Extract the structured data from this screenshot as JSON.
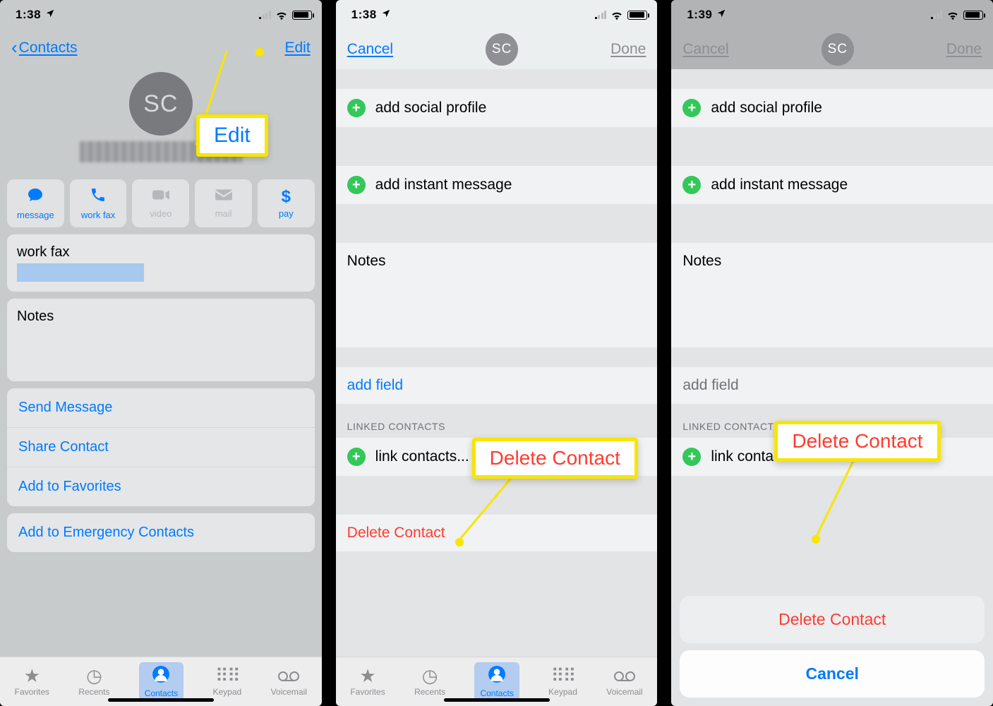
{
  "status": {
    "time1": "1:38",
    "time2": "1:38",
    "time3": "1:39"
  },
  "panel1": {
    "back": "Contacts",
    "edit": "Edit",
    "initials": "SC",
    "callout": "Edit",
    "actions": {
      "message": "message",
      "workfax": "work fax",
      "video": "video",
      "mail": "mail",
      "pay": "pay"
    },
    "workfax_label": "work fax",
    "notes_label": "Notes",
    "send_message": "Send Message",
    "share_contact": "Share Contact",
    "add_favorites": "Add to Favorites",
    "add_emergency": "Add to Emergency Contacts",
    "tabs": {
      "fav": "Favorites",
      "recents": "Recents",
      "contacts": "Contacts",
      "keypad": "Keypad",
      "vm": "Voicemail"
    }
  },
  "panel2": {
    "cancel": "Cancel",
    "done": "Done",
    "initials": "SC",
    "add_social": "add social profile",
    "add_im": "add instant message",
    "notes": "Notes",
    "add_field": "add field",
    "linked_hdr": "LINKED CONTACTS",
    "link_contacts": "link contacts...",
    "delete": "Delete Contact",
    "callout": "Delete Contact",
    "tabs": {
      "fav": "Favorites",
      "recents": "Recents",
      "contacts": "Contacts",
      "keypad": "Keypad",
      "vm": "Voicemail"
    }
  },
  "panel3": {
    "cancel": "Cancel",
    "done": "Done",
    "initials": "SC",
    "add_social": "add social profile",
    "add_im": "add instant message",
    "notes": "Notes",
    "add_field": "add field",
    "linked_hdr": "LINKED CONTACTS",
    "link_contacts": "link contacts...",
    "callout": "Delete Contact",
    "sheet_delete": "Delete Contact",
    "sheet_cancel": "Cancel"
  }
}
